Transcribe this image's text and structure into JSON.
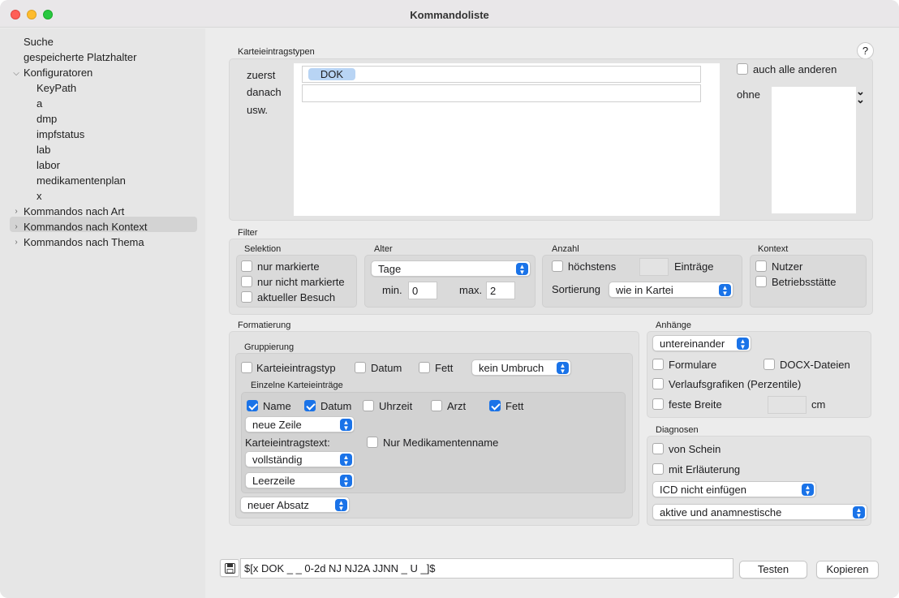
{
  "window": {
    "title": "Kommandoliste"
  },
  "sidebar": {
    "items": [
      {
        "label": "Suche"
      },
      {
        "label": "gespeicherte Platzhalter"
      },
      {
        "label": "Konfiguratoren"
      },
      {
        "label": "KeyPath"
      },
      {
        "label": "a"
      },
      {
        "label": "dmp"
      },
      {
        "label": "impfstatus"
      },
      {
        "label": "lab"
      },
      {
        "label": "labor"
      },
      {
        "label": "medikamentenplan"
      },
      {
        "label": "x"
      },
      {
        "label": "Kommandos nach Art"
      },
      {
        "label": "Kommandos nach Kontext"
      },
      {
        "label": "Kommandos nach Thema"
      }
    ]
  },
  "types": {
    "heading": "Karteieintragstypen",
    "first_label": "zuerst",
    "then_label": "danach",
    "etc_label": "usw.",
    "tag": "DOK",
    "all_others": "auch alle anderen",
    "without_label": "ohne",
    "help": "?"
  },
  "filter": {
    "heading": "Filter",
    "selection": {
      "heading": "Selektion",
      "items": [
        "nur markierte",
        "nur nicht markierte",
        "aktueller Besuch"
      ]
    },
    "age": {
      "heading": "Alter",
      "unit": "Tage",
      "min_label": "min.",
      "min_value": "0",
      "max_label": "max.",
      "max_value": "2"
    },
    "count": {
      "heading": "Anzahl",
      "max_label": "höchstens",
      "entries_label": "Einträge",
      "sort_label": "Sortierung",
      "sort_value": "wie in Kartei"
    },
    "context": {
      "heading": "Kontext",
      "items": [
        "Nutzer",
        "Betriebsstätte"
      ]
    }
  },
  "format": {
    "heading": "Formatierung",
    "grouping": {
      "heading": "Gruppierung",
      "type_label": "Karteieintragstyp",
      "date_label": "Datum",
      "bold_label": "Fett",
      "wrap_value": "kein Umbruch"
    },
    "single": {
      "heading": "Einzelne Karteieinträge",
      "name_label": "Name",
      "date_label": "Datum",
      "time_label": "Uhrzeit",
      "doctor_label": "Arzt",
      "bold_label": "Fett",
      "line_value": "neue Zeile",
      "text_label": "Karteieintragstext:",
      "med_only_label": "Nur Medikamentenname",
      "text_value": "vollständig",
      "spacing_value": "Leerzeile"
    },
    "paragraph_value": "neuer Absatz"
  },
  "attachments": {
    "heading": "Anhänge",
    "layout_value": "untereinander",
    "forms_label": "Formulare",
    "docx_label": "DOCX-Dateien",
    "charts_label": "Verlaufsgrafiken (Perzentile)",
    "fixed_width_label": "feste Breite",
    "unit": "cm"
  },
  "diagnoses": {
    "heading": "Diagnosen",
    "from_cert_label": "von Schein",
    "with_expl_label": "mit Erläuterung",
    "icd_value": "ICD nicht einfügen",
    "active_value": "aktive und anamnestische"
  },
  "command": {
    "value": "$[x DOK _ _ 0-2d NJ NJ2A JJNN _ U _]$",
    "test_button": "Testen",
    "copy_button": "Kopieren"
  },
  "colors": {
    "accent": "#1a73e8",
    "tag": "#b8d4f4"
  }
}
